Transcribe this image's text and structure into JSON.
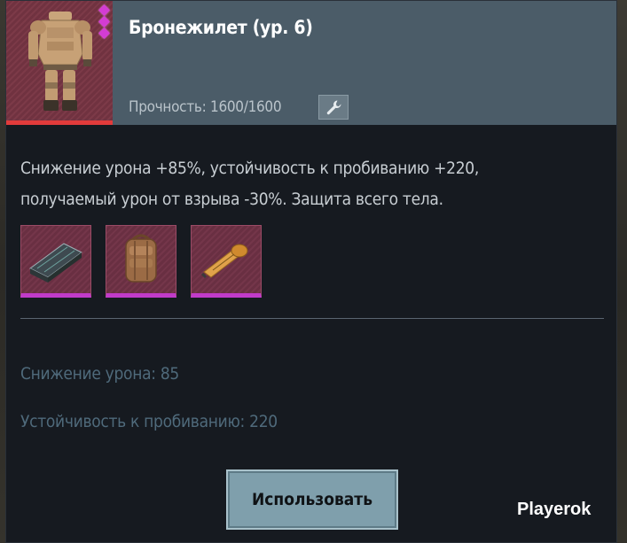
{
  "item": {
    "title": "Бронежилет (ур. 6)",
    "durability_label": "Прочность: 1600/1600",
    "rarity_pips": 3,
    "icon": "armor-suit-icon"
  },
  "description": {
    "line1": "Снижение урона +85%, устойчивость к пробиванию +220,",
    "line2": "получаемый урон от взрыва -30%. Защита всего тела."
  },
  "materials": [
    {
      "name": "metal-case-icon"
    },
    {
      "name": "backpack-icon"
    },
    {
      "name": "tape-measure-icon"
    }
  ],
  "stats": {
    "damage_reduction": "Снижение урона: 85",
    "penetration_resistance": "Устойчивость к пробиванию: 220"
  },
  "actions": {
    "use_label": "Использовать"
  },
  "repair_icon": "wrench-icon",
  "watermark": "Playerok",
  "colors": {
    "header": "#4b5c68",
    "panel": "#161a20",
    "rarity_accent": "#c13bc9",
    "health_bar": "#e23b3b",
    "stat_text": "#4f6a7b",
    "button": "#7f9fac"
  }
}
